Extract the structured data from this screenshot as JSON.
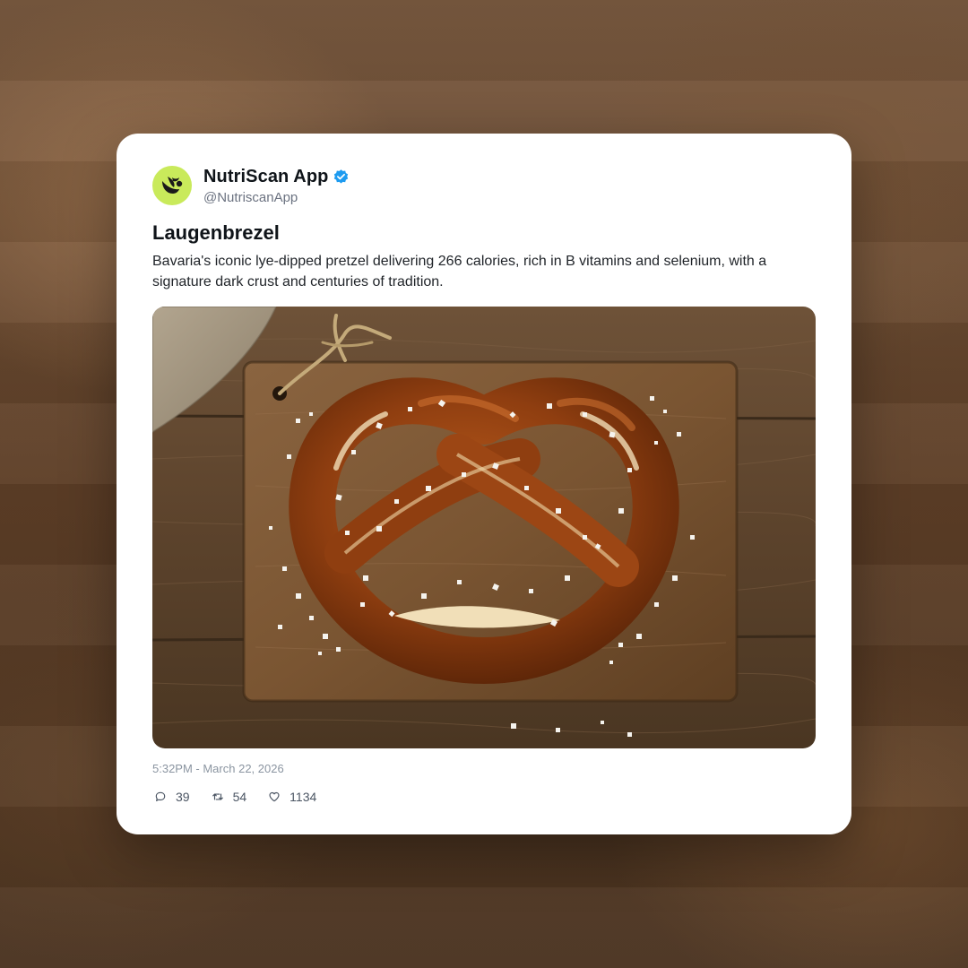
{
  "post": {
    "display_name": "NutriScan App",
    "handle": "@NutriscanApp",
    "verified": true,
    "title": "Laugenbrezel",
    "description": "Bavaria's iconic lye-dipped pretzel delivering 266 calories, rich in B vitamins and selenium, with a signature dark crust and centuries of tradition.",
    "timestamp": "5:32PM - March 22, 2026",
    "stats": {
      "replies": "39",
      "retweets": "54",
      "likes": "1134"
    }
  },
  "icons": {
    "avatar": "leaf-logo-icon",
    "verified": "verified-badge-icon",
    "replies": "comment-icon",
    "retweets": "retweet-icon",
    "likes": "heart-icon"
  },
  "colors": {
    "avatar_bg": "#c9ea5b",
    "verified": "#1d9bf0",
    "text_primary": "#0f1419",
    "text_muted": "#8b95a1"
  }
}
